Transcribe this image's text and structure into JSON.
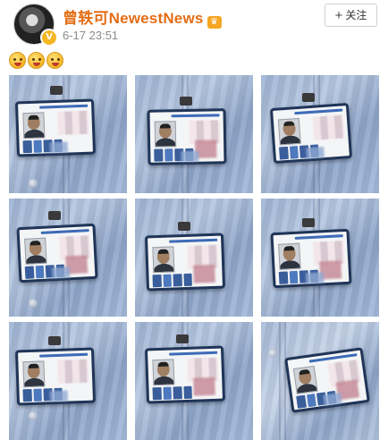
{
  "post": {
    "author": "曾轶可NewestNews",
    "timestamp": "6-17 23:51",
    "emoji_names": [
      "drool-emoji",
      "drool-emoji",
      "drool-emoji"
    ]
  },
  "follow_button": {
    "icon": "plus-icon",
    "label": "关注"
  },
  "photos": [
    "photo-1",
    "photo-2",
    "photo-3",
    "photo-4",
    "photo-5",
    "photo-6",
    "photo-7",
    "photo-8",
    "photo-9"
  ],
  "colors": {
    "username": "#e46d15",
    "timestamp": "#8a8a8a",
    "card_border": "#1f3558"
  }
}
